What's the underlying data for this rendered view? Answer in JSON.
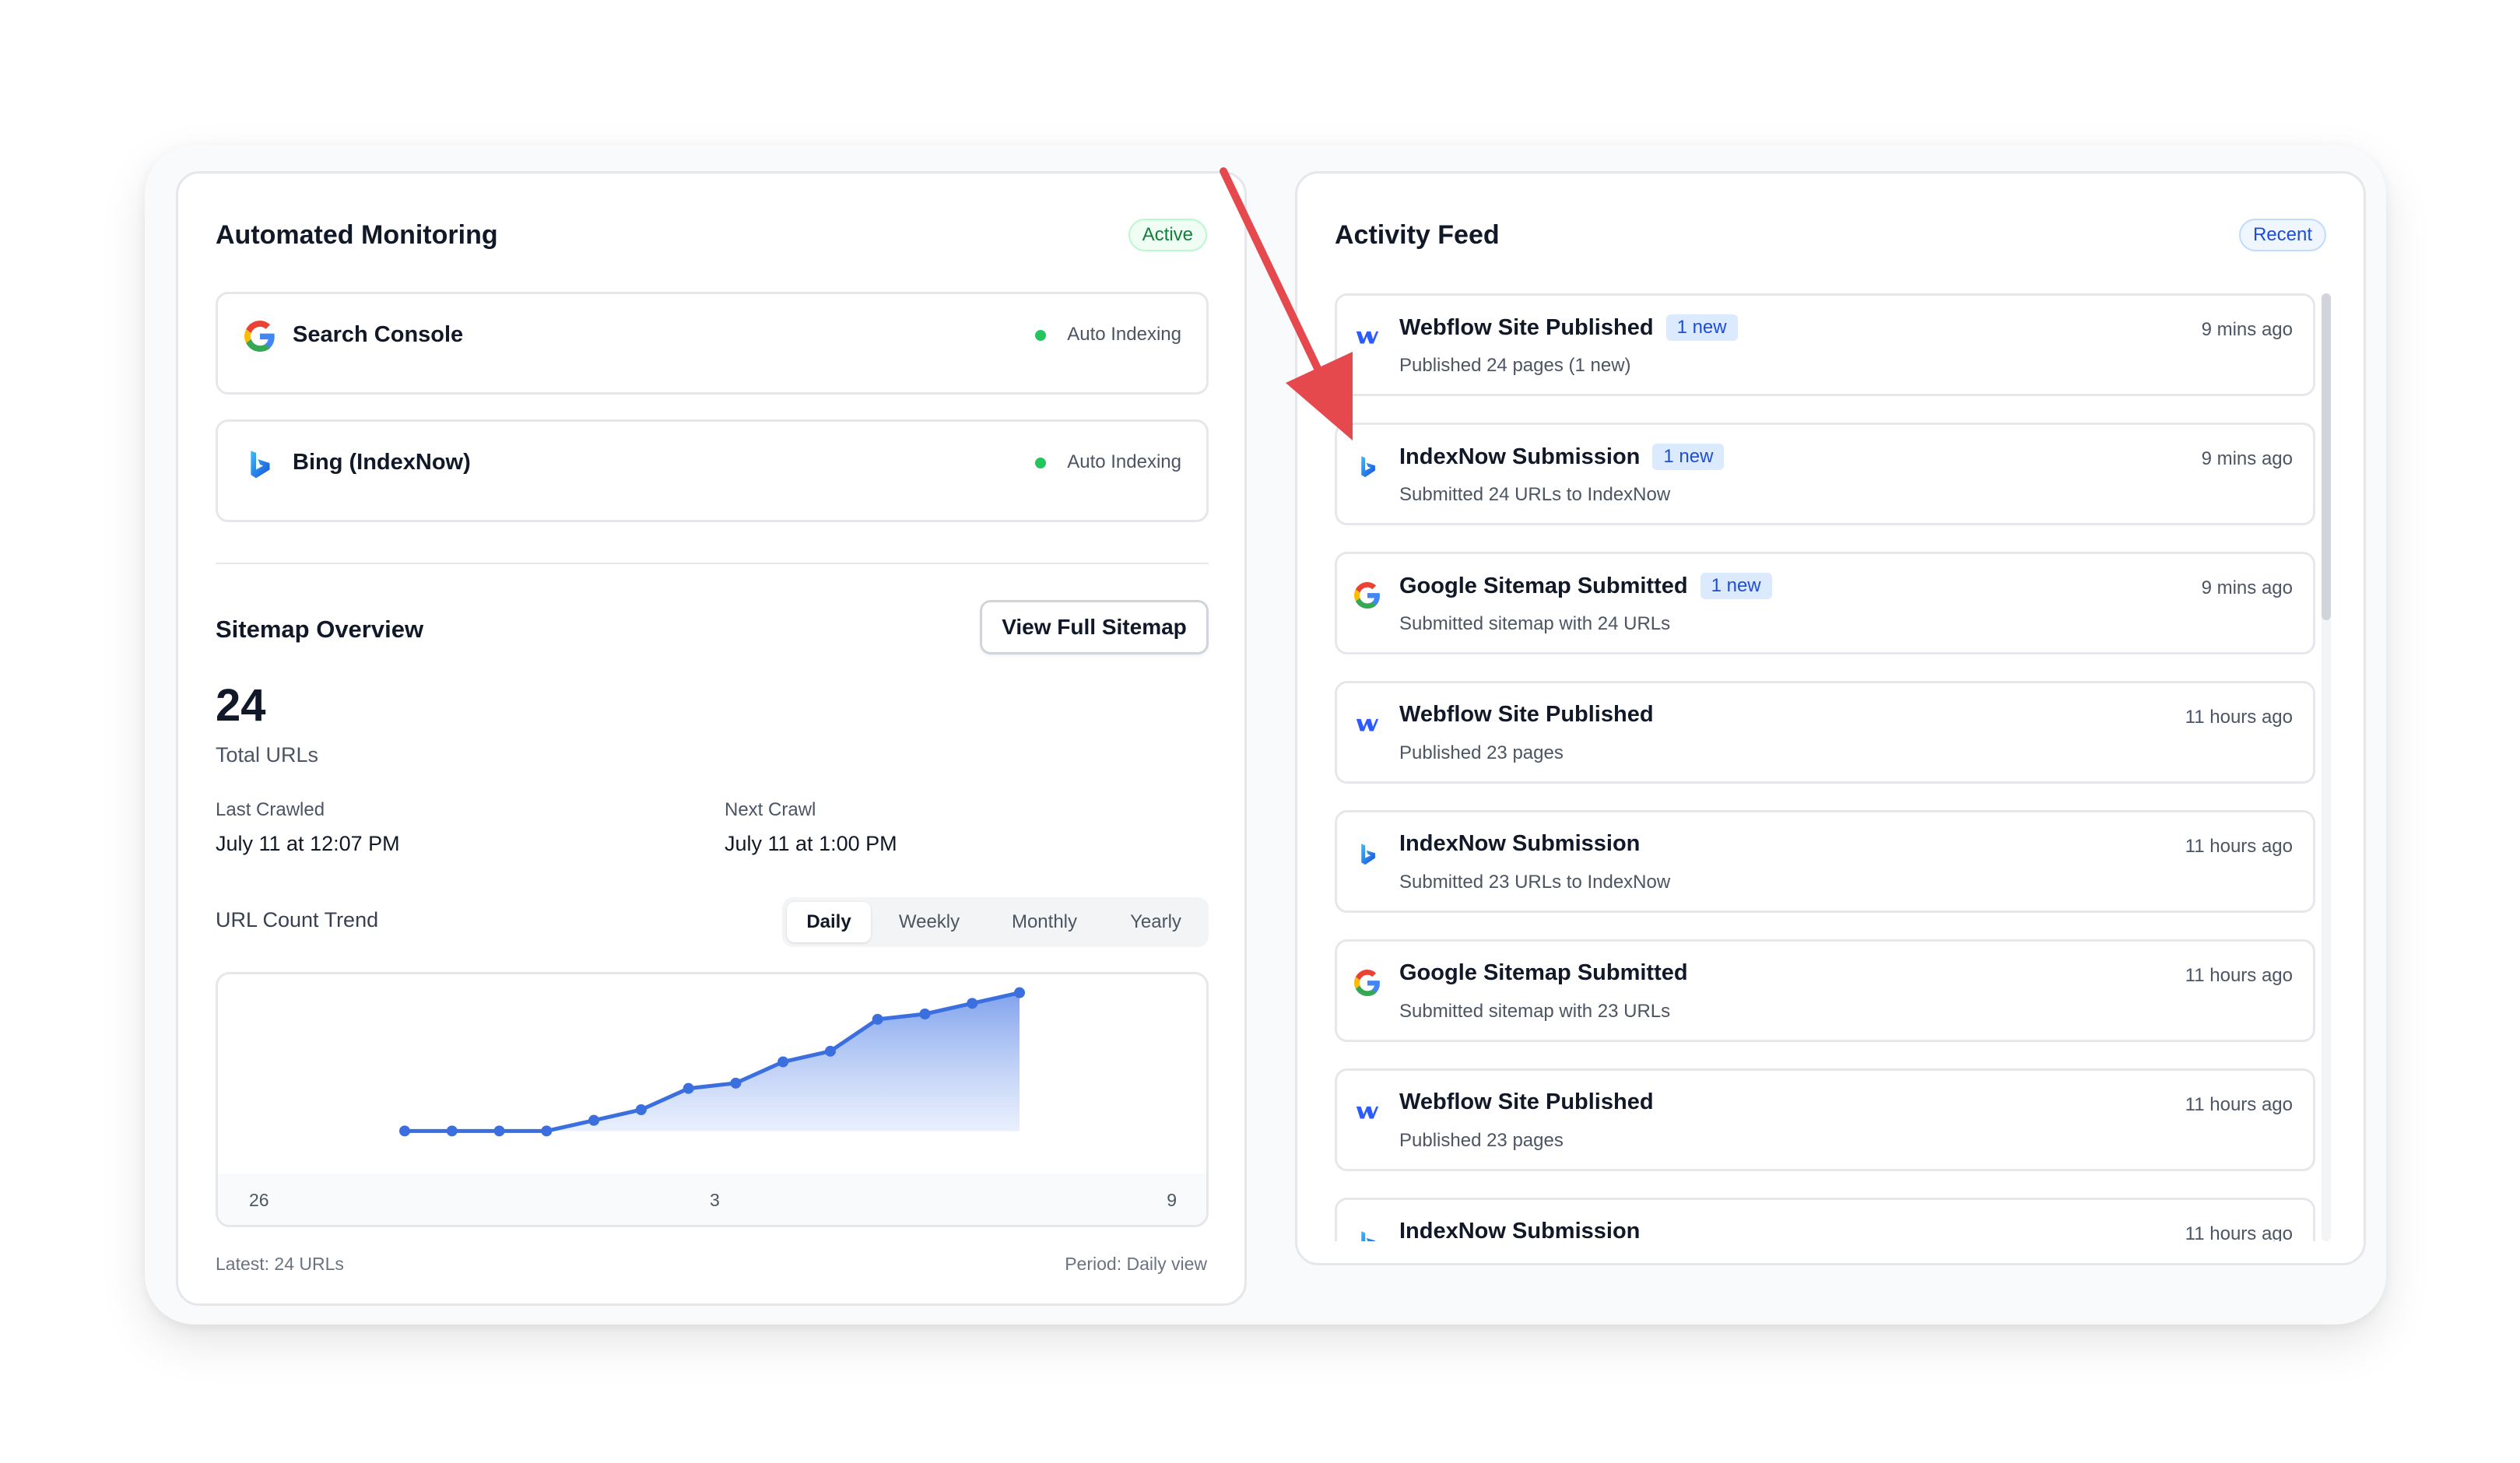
{
  "monitoring": {
    "title": "Automated Monitoring",
    "status_badge": "Active",
    "services": [
      {
        "name": "Search Console",
        "status": "Auto Indexing",
        "icon": "google-icon"
      },
      {
        "name": "Bing (IndexNow)",
        "status": "Auto Indexing",
        "icon": "bing-icon"
      }
    ]
  },
  "sitemap": {
    "title": "Sitemap Overview",
    "view_button": "View Full Sitemap",
    "total": "24",
    "total_label": "Total URLs",
    "last_crawled_label": "Last Crawled",
    "last_crawled_value": "July 11 at 12:07 PM",
    "next_crawl_label": "Next Crawl",
    "next_crawl_value": "July 11 at 1:00 PM",
    "trend_label": "URL Count Trend",
    "periods": [
      "Daily",
      "Weekly",
      "Monthly",
      "Yearly"
    ],
    "active_period": "Daily",
    "latest": "Latest: 24 URLs",
    "period_note": "Period: Daily view"
  },
  "chart_data": {
    "type": "area",
    "x_tick_labels": [
      "26",
      "3",
      "9"
    ],
    "values": [
      8,
      8,
      8,
      8,
      9,
      10,
      12,
      12.5,
      14.5,
      15.5,
      18.5,
      19,
      20,
      21
    ],
    "ylim": [
      4,
      22
    ],
    "grid": false,
    "color": "#3b6fe0"
  },
  "activity": {
    "title": "Activity Feed",
    "badge": "Recent",
    "items": [
      {
        "icon": "webflow-icon",
        "title": "Webflow Site Published",
        "new": "1 new",
        "subtitle": "Published 24 pages (1 new)",
        "time": "9 mins ago"
      },
      {
        "icon": "bing-icon",
        "title": "IndexNow Submission",
        "new": "1 new",
        "subtitle": "Submitted 24 URLs to IndexNow",
        "time": "9 mins ago"
      },
      {
        "icon": "google-icon",
        "title": "Google Sitemap Submitted",
        "new": "1 new",
        "subtitle": "Submitted sitemap with 24 URLs",
        "time": "9 mins ago"
      },
      {
        "icon": "webflow-icon",
        "title": "Webflow Site Published",
        "new": "",
        "subtitle": "Published 23 pages",
        "time": "11 hours ago"
      },
      {
        "icon": "bing-icon",
        "title": "IndexNow Submission",
        "new": "",
        "subtitle": "Submitted 23 URLs to IndexNow",
        "time": "11 hours ago"
      },
      {
        "icon": "google-icon",
        "title": "Google Sitemap Submitted",
        "new": "",
        "subtitle": "Submitted sitemap with 23 URLs",
        "time": "11 hours ago"
      },
      {
        "icon": "webflow-icon",
        "title": "Webflow Site Published",
        "new": "",
        "subtitle": "Published 23 pages",
        "time": "11 hours ago"
      },
      {
        "icon": "bing-icon",
        "title": "IndexNow Submission",
        "new": "",
        "subtitle": "",
        "time": "11 hours ago"
      }
    ]
  },
  "colors": {
    "accent": "#3b6fe0",
    "annotation_arrow": "#e5484d",
    "active_green": "#22c55e"
  }
}
